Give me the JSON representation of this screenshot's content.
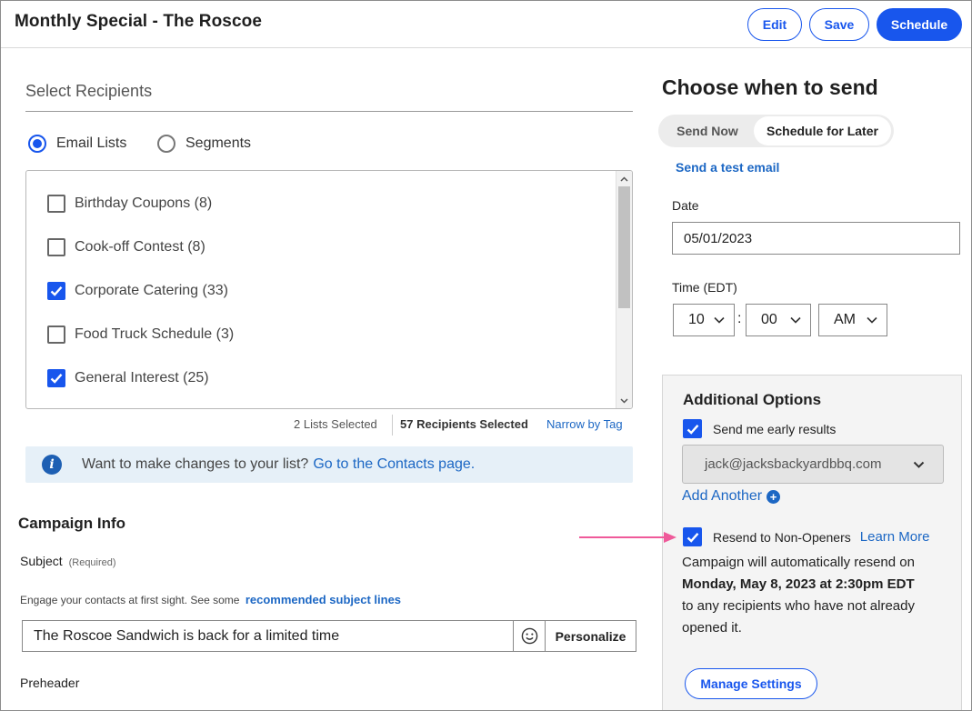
{
  "header": {
    "title": "Monthly Special - The Roscoe",
    "edit_label": "Edit",
    "save_label": "Save",
    "schedule_label": "Schedule",
    "accent_color": "#1856ed"
  },
  "recipients": {
    "title": "Select Recipients",
    "tabs": [
      {
        "label": "Email Lists",
        "selected": true
      },
      {
        "label": "Segments",
        "selected": false
      }
    ],
    "lists": [
      {
        "label": "Birthday Coupons (8)",
        "checked": false
      },
      {
        "label": "Cook-off Contest (8)",
        "checked": false
      },
      {
        "label": "Corporate Catering (33)",
        "checked": true
      },
      {
        "label": "Food Truck Schedule (3)",
        "checked": false
      },
      {
        "label": "General Interest (25)",
        "checked": true
      }
    ],
    "lists_selected": "2 Lists Selected",
    "recipients_selected": "57 Recipients Selected",
    "narrow_by_tag": "Narrow by Tag",
    "info_text": "Want to make changes to your list?",
    "info_link": "Go to the Contacts page."
  },
  "campaign": {
    "title": "Campaign Info",
    "subject_label": "Subject",
    "subject_required": "(Required)",
    "help_text": "Engage your contacts at first sight. See some",
    "help_link": "recommended subject lines",
    "subject_value": "The Roscoe Sandwich is back for a limited time",
    "personalize_label": "Personalize",
    "preheader_label": "Preheader"
  },
  "send": {
    "title": "Choose when to send",
    "send_now": "Send Now",
    "schedule_later": "Schedule for Later",
    "test_email_link": "Send a test email",
    "date_label": "Date",
    "date_value": "05/01/2023",
    "time_label": "Time (EDT)",
    "hour": "10",
    "colon": ":",
    "minute": "00",
    "ampm": "AM"
  },
  "options": {
    "title": "Additional Options",
    "early_results_label": "Send me early results",
    "early_results_checked": true,
    "email_value": "jack@jacksbackyardbbq.com",
    "add_another": "Add Another",
    "resend_label": "Resend to Non-Openers",
    "resend_checked": true,
    "learn_more": "Learn More",
    "resend_desc_1": "Campaign will automatically resend on",
    "resend_date": "Monday, May 8, 2023 at 2:30pm EDT",
    "resend_desc_2": "to any recipients who have not already opened it.",
    "manage_settings": "Manage Settings"
  },
  "annotation": {
    "arrow_color": "#ef5a9a"
  }
}
